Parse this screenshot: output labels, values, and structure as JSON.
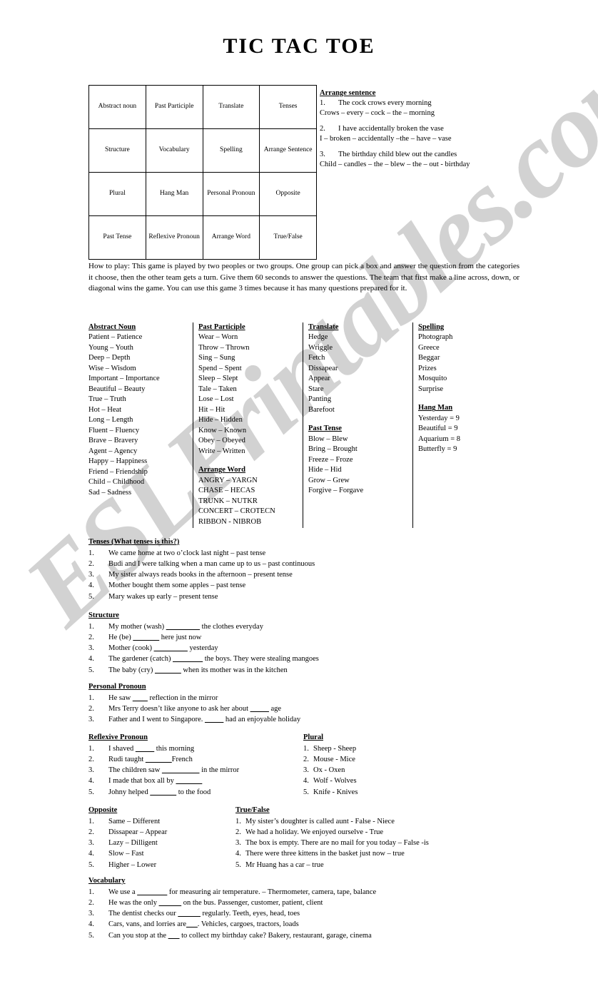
{
  "document": {
    "title": "TIC TAC TOE",
    "watermark": "ESLPrintables.com"
  },
  "grid": {
    "rows": [
      [
        "Abstract noun",
        "Past Participle",
        "Translate",
        "Tenses"
      ],
      [
        "Structure",
        "Vocabulary",
        "Spelling",
        "Arrange Sentence"
      ],
      [
        "Plural",
        "Hang Man",
        "Personal Pronoun",
        "Opposite"
      ],
      [
        "Past Tense",
        "Reflexive Pronoun",
        "Arrange Word",
        "True/False"
      ]
    ]
  },
  "arrange_sentence": {
    "heading": "Arrange sentence",
    "items": [
      {
        "num": "1.",
        "question": "The cock crows every morning",
        "scrambled": "Crows – every – cock – the – morning"
      },
      {
        "num": "2.",
        "question": "I have accidentally broken the vase",
        "scrambled": "I –  broken – accidentally –the – have – vase"
      },
      {
        "num": "3.",
        "question": "The birthday child blew out the candles",
        "scrambled": "Child – candles – the – blew – the – out - birthday"
      }
    ]
  },
  "how_to_play": "How to play: This game is played by two peoples or two groups. One group can pick a box and answer the question from the categories it choose, then the other team gets a turn. Give them 60 seconds to answer the questions. The team that first make a line across, down, or diagonal wins the game. You can use this game 3 times because it has many questions prepared for it.",
  "columns": {
    "abstract_noun": {
      "heading": "Abstract Noun",
      "items": [
        "Patient – Patience",
        "Young – Youth",
        "Deep – Depth",
        "Wise – Wisdom",
        "Important – Importance",
        "Beautiful – Beauty",
        "True – Truth",
        "Hot – Heat",
        "Long – Length",
        "Fluent – Fluency",
        "Brave – Bravery",
        "Agent – Agency",
        "Happy – Happiness",
        "Friend – Friendship",
        "Child – Childhood",
        "Sad – Sadness"
      ]
    },
    "past_participle": {
      "heading": "Past Participle",
      "items": [
        "Wear – Worn",
        "Throw – Thrown",
        "Sing – Sung",
        "Spend – Spent",
        "Sleep – Slept",
        "Tale – Taken",
        "Lose – Lost",
        "Hit – Hit",
        "Hide – Hidden",
        "Know – Known",
        "Obey – Obeyed",
        "Write – Written"
      ]
    },
    "arrange_word": {
      "heading": "Arrange Word",
      "items": [
        "ANGRY – YARGN",
        "CHASE – HECAS",
        "TRUNK – NUTKR",
        "CONCERT – CROTECN",
        "RIBBON - NIBROB"
      ]
    },
    "translate": {
      "heading": "Translate",
      "items": [
        "Hedge",
        "Wriggle",
        "Fetch",
        "Dissapear",
        "Appear",
        "Stare",
        "Panting",
        "Barefoot"
      ]
    },
    "past_tense": {
      "heading": "Past Tense",
      "items": [
        "Blow – Blew",
        "Bring – Brought",
        "Freeze – Froze",
        "Hide – Hid",
        "Grow – Grew",
        "Forgive – Forgave"
      ]
    },
    "spelling": {
      "heading": "Spelling",
      "items": [
        "Photograph",
        "Greece",
        "Beggar",
        "Prizes",
        "Mosquito",
        "Surprise"
      ]
    },
    "hang_man": {
      "heading": "Hang Man",
      "items": [
        "Yesterday = 9",
        "Beautiful = 9",
        "Aquarium = 8",
        "Butterfly = 9"
      ]
    }
  },
  "sections": {
    "tenses": {
      "heading": "Tenses (What tenses is this?)",
      "items": [
        {
          "num": "1.",
          "text": "We came home at two o’clock last night – past tense"
        },
        {
          "num": "2.",
          "text": "Budi and I were talking when a man came up to us – past continuous"
        },
        {
          "num": "3.",
          "text": "My sister always reads books in the afternoon – present tense"
        },
        {
          "num": "4.",
          "text": "Mother bought them some apples – past tense"
        },
        {
          "num": "5.",
          "text": "Mary wakes up early – present tense"
        }
      ]
    },
    "structure": {
      "heading": "Structure",
      "items": [
        {
          "num": "1.",
          "before": "My mother (wash)",
          "blank": "_________",
          "after": " the clothes everyday"
        },
        {
          "num": "2.",
          "before": "He (be)",
          "blank": "_______",
          "after": " here just now"
        },
        {
          "num": "3.",
          "before": "Mother (cook)",
          "blank": "_________",
          "after": " yesterday"
        },
        {
          "num": "4.",
          "before": "The gardener (catch)",
          "blank": "________",
          "after": " the boys. They were stealing mangoes"
        },
        {
          "num": "5.",
          "before": "The baby (cry)",
          "blank": "_______",
          "after": " when its mother was in the kitchen"
        }
      ]
    },
    "personal_pronoun": {
      "heading": "Personal Pronoun",
      "items": [
        {
          "num": "1.",
          "before": "He saw",
          "blank": "____",
          "after": " reflection in the mirror"
        },
        {
          "num": "2.",
          "before": "Mrs Terry doesn’t like anyone to ask her about",
          "blank": "_____",
          "after": " age"
        },
        {
          "num": "3.",
          "before": "Father and I went to Singapore.",
          "blank": "_____",
          "after": " had an enjoyable holiday"
        }
      ]
    },
    "reflexive_pronoun": {
      "heading": "Reflexive Pronoun",
      "items": [
        {
          "num": "1.",
          "before": "I shaved",
          "blank": "_____",
          "after": " this morning"
        },
        {
          "num": "2.",
          "before": "Rudi taught",
          "blank": "_______",
          "after": "French"
        },
        {
          "num": "3.",
          "before": "The children saw",
          "blank": "__________",
          "after": " in the mirror"
        },
        {
          "num": "4.",
          "before": "I made that box all by",
          "blank": "_______",
          "after": ""
        },
        {
          "num": "5.",
          "before": "Johny helped",
          "blank": "_______",
          "after": " to the food"
        }
      ]
    },
    "plural": {
      "heading": "Plural",
      "items": [
        {
          "num": "1.",
          "text": "Sheep - Sheep"
        },
        {
          "num": "2.",
          "text": "Mouse - Mice"
        },
        {
          "num": "3.",
          "text": "Ox - Oxen"
        },
        {
          "num": "4.",
          "text": "Wolf - Wolves"
        },
        {
          "num": "5.",
          "text": "Knife - Knives"
        }
      ]
    },
    "opposite": {
      "heading": "Opposite",
      "items": [
        {
          "num": "1.",
          "text": "Same – Different"
        },
        {
          "num": "2.",
          "text": "Dissapear – Appear"
        },
        {
          "num": "3.",
          "text": "Lazy – Dilligent"
        },
        {
          "num": "4.",
          "text": "Slow – Fast"
        },
        {
          "num": "5.",
          "text": "Higher – Lower"
        }
      ]
    },
    "true_false": {
      "heading": "True/False",
      "items": [
        {
          "num": "1.",
          "text": "My sister’s doughter is called aunt - False - Niece"
        },
        {
          "num": "2.",
          "text": "We had a holiday. We enjoyed ourselve - True"
        },
        {
          "num": "3.",
          "text": "The box is empty. There are no mail for you today – False -is"
        },
        {
          "num": "4.",
          "text": "There were three kittens in the basket just now – true"
        },
        {
          "num": "5.",
          "text": "Mr Huang has a car – true"
        }
      ]
    },
    "vocabulary": {
      "heading": "Vocabulary",
      "items": [
        {
          "num": "1.",
          "before": "We use a",
          "blank": "________",
          "after": " for measuring air temperature. – Thermometer, camera, tape, balance"
        },
        {
          "num": "2.",
          "before": "He was the only",
          "blank": "______",
          "after": " on the bus. Passenger, customer, patient, client"
        },
        {
          "num": "3.",
          "before": "The dentist checks our",
          "blank": "______",
          "after": " regularly. Teeth, eyes, head, toes"
        },
        {
          "num": "4.",
          "before": "Cars, vans, and lorries are",
          "blank": "___",
          "after": ". Vehicles, cargoes, tractors, loads"
        },
        {
          "num": "5.",
          "before": "Can you stop at the",
          "blank": "___",
          "after": " to collect my birthday cake? Bakery, restaurant, garage, cinema"
        }
      ]
    }
  }
}
